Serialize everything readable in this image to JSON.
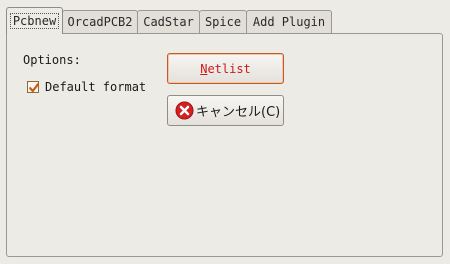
{
  "tabs": [
    {
      "label": "Pcbnew",
      "active": true
    },
    {
      "label": "OrcadPCB2",
      "active": false
    },
    {
      "label": "CadStar",
      "active": false
    },
    {
      "label": "Spice",
      "active": false
    },
    {
      "label": "Add Plugin",
      "active": false
    }
  ],
  "panel": {
    "options_label": "Options:",
    "default_format_label": "Default format",
    "default_format_checked": true,
    "netlist_button_label": "Netlist",
    "cancel_button_label": "キャンセル(C)"
  },
  "colors": {
    "background": "#edebe6",
    "netlist_text": "#cc1a1a",
    "focus_border": "#c3582a",
    "cancel_icon": "#d42020",
    "checkbox_mark": "#c06010"
  }
}
